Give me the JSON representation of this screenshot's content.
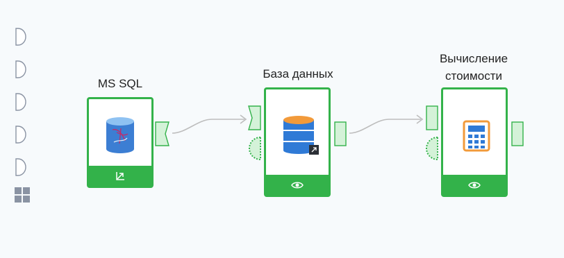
{
  "canvas": {
    "background": "#f7fafc",
    "accent": "#33b24a",
    "port_fill": "#d4f2d8",
    "wire_color": "#bdbdbd"
  },
  "palette": {
    "items": [
      {
        "icon": "half-circle-port-icon"
      },
      {
        "icon": "half-circle-port-icon"
      },
      {
        "icon": "half-circle-port-icon"
      },
      {
        "icon": "half-circle-port-icon"
      },
      {
        "icon": "half-circle-port-icon"
      }
    ],
    "grid_icon": "grid-icon"
  },
  "nodes": [
    {
      "id": "ms-sql",
      "title": "MS SQL",
      "icon": "sql-database-icon",
      "footer_icon": "import-arrow-icon"
    },
    {
      "id": "database",
      "title": "База данных",
      "icon": "database-icon",
      "footer_icon": "eye-icon"
    },
    {
      "id": "calc",
      "title_line1": "Вычисление",
      "title_line2": "стоимости",
      "icon": "calculator-icon",
      "footer_icon": "eye-icon"
    }
  ]
}
